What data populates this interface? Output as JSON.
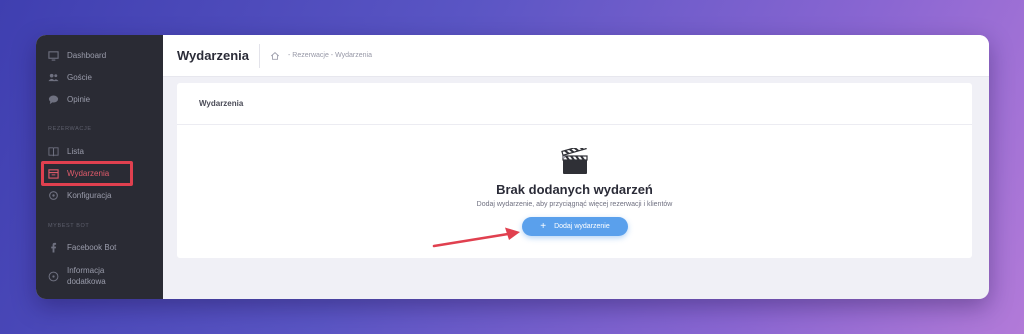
{
  "sidebar": {
    "items": [
      {
        "label": "Dashboard",
        "icon": "monitor-icon"
      },
      {
        "label": "Goście",
        "icon": "users-icon"
      },
      {
        "label": "Opinie",
        "icon": "comment-icon"
      }
    ],
    "section_reservations": "REZERWACJE",
    "reservation_items": [
      {
        "label": "Lista",
        "icon": "book-icon"
      },
      {
        "label": "Wydarzenia",
        "icon": "calendar-icon"
      },
      {
        "label": "Konfiguracja",
        "icon": "gear-icon"
      }
    ],
    "section_bot": "MYBEST BOT",
    "bot_items": [
      {
        "label": "Facebook Bot",
        "icon": "facebook-icon"
      },
      {
        "label": "Informacja",
        "label2": "dodatkowa",
        "icon": "info-icon"
      }
    ]
  },
  "header": {
    "title": "Wydarzenia",
    "breadcrumb": "- Rezerwacje - Wydarzenia"
  },
  "card": {
    "title": "Wydarzenia",
    "empty_title": "Brak dodanych wydarzeń",
    "empty_subtitle": "Dodaj wydarzenie, aby przyciągnąć więcej rezerwacji i klientów",
    "add_button": "Dodaj wydarzenie"
  },
  "colors": {
    "sidebar_bg": "#2a2b34",
    "active": "#e15b6b",
    "button": "#5aa0ec",
    "highlight": "#e0404f"
  }
}
